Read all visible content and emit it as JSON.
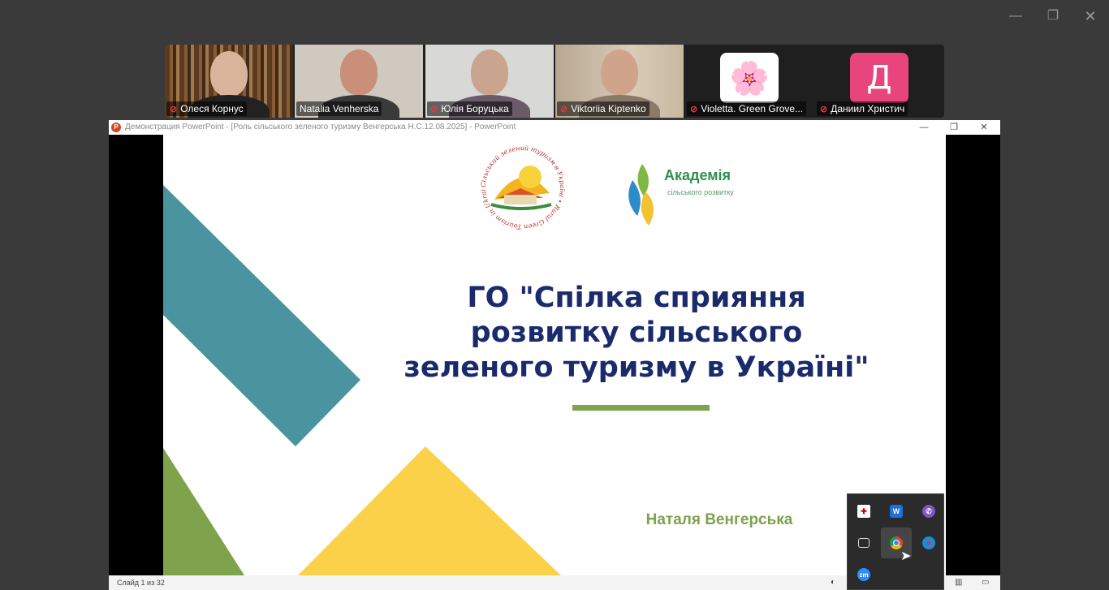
{
  "window_controls": {
    "minimize": "—",
    "maximize": "❐",
    "close": "✕"
  },
  "participants": [
    {
      "name": "Олеся Корнус",
      "muted": true,
      "mic_icon": "mic-off-icon"
    },
    {
      "name": "Natalia Venherska",
      "muted": false,
      "active_speaker": true
    },
    {
      "name": "Юлія Боруцька",
      "muted": true,
      "mic_icon": "mic-off-icon"
    },
    {
      "name": "Viktoriia Kiptenko",
      "muted": true,
      "mic_icon": "mic-off-icon"
    },
    {
      "name": "Violetta. Green Grove...",
      "muted": true,
      "mic_icon": "mic-off-icon",
      "avatar": "🌸",
      "avatar_color": "#ffffff"
    },
    {
      "name": "Даниил Христич",
      "muted": true,
      "mic_icon": "mic-off-icon",
      "avatar": "Д",
      "avatar_color": "#e8457c"
    }
  ],
  "powerpoint": {
    "title_bar": "Демонстрация PowerPoint - [Роль сільського зеленого  туризму  Венгерська Н.С.12.08.2025] - PowerPoint",
    "controls": {
      "minimize": "—",
      "maximize": "❐",
      "close": "✕"
    },
    "slide": {
      "title": "ГО \"Спілка сприяння розвитку сільського зеленого туризму в Україні\"",
      "author": "Наталя Венгерська",
      "logo_right_main": "Академія",
      "logo_right_sub": "сільського розвитку",
      "logo_left_text": "Сільський зелений туризм в Україні • Rural Green Tourism in Ukraine",
      "colors": {
        "teal": "#4a949f",
        "green": "#7ea34c",
        "yellow": "#fcd14a",
        "title": "#1a2a6b"
      }
    },
    "status_bar": {
      "slide_count": "Слайд 1 из 32"
    }
  },
  "tray_icons": [
    {
      "name": "security-shield-icon"
    },
    {
      "name": "waves-app-icon"
    },
    {
      "name": "viber-icon"
    },
    {
      "name": "teams-camera-icon"
    },
    {
      "name": "chrome-icon"
    },
    {
      "name": "screen-share-icon"
    },
    {
      "name": "zoom-icon",
      "label": "zm"
    }
  ]
}
